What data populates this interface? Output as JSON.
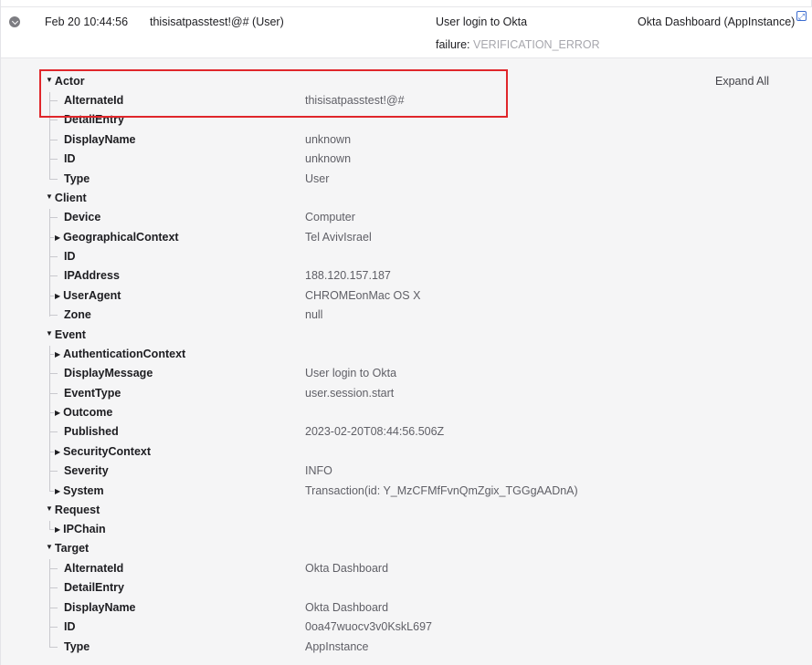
{
  "event": {
    "time": "Feb 20 10:44:56",
    "actor": "thisisatpasstest!@# (User)",
    "message": "User login to Okta",
    "outcome_label": "failure",
    "outcome_reason": "VERIFICATION_ERROR",
    "target": "Okta Dashboard  (AppInstance)"
  },
  "detail": {
    "expand_all": "Expand All",
    "sections": [
      {
        "label": "Actor",
        "rows": [
          {
            "label": "AlternateId",
            "value": "thisisatpasstest!@#"
          },
          {
            "label": "DetailEntry",
            "value": ""
          },
          {
            "label": "DisplayName",
            "value": "unknown"
          },
          {
            "label": "ID",
            "value": "unknown"
          },
          {
            "label": "Type",
            "value": "User"
          }
        ]
      },
      {
        "label": "Client",
        "rows": [
          {
            "label": "Device",
            "value": "Computer"
          },
          {
            "label": "GeographicalContext",
            "value": "Tel AvivIsrael"
          },
          {
            "label": "ID",
            "value": ""
          },
          {
            "label": "IPAddress",
            "value": "188.120.157.187"
          },
          {
            "label": "UserAgent",
            "value": "CHROMEonMac OS X"
          },
          {
            "label": "Zone",
            "value": "null"
          }
        ]
      },
      {
        "label": "Event",
        "rows": [
          {
            "label": "AuthenticationContext",
            "value": ""
          },
          {
            "label": "DisplayMessage",
            "value": "User login to Okta"
          },
          {
            "label": "EventType",
            "value": "user.session.start"
          },
          {
            "label": "Outcome",
            "value": ""
          },
          {
            "label": "Published",
            "value": "2023-02-20T08:44:56.506Z"
          },
          {
            "label": "SecurityContext",
            "value": ""
          },
          {
            "label": "Severity",
            "value": "INFO"
          },
          {
            "label": "System",
            "value": "Transaction(id: Y_MzCFMfFvnQmZgix_TGGgAADnA)"
          }
        ]
      },
      {
        "label": "Request",
        "rows": [
          {
            "label": "IPChain",
            "value": ""
          }
        ]
      },
      {
        "label": "Target",
        "rows": [
          {
            "label": "AlternateId",
            "value": "Okta Dashboard"
          },
          {
            "label": "DetailEntry",
            "value": ""
          },
          {
            "label": "DisplayName",
            "value": "Okta Dashboard"
          },
          {
            "label": "ID",
            "value": "0oa47wuocv3v0KskL697"
          },
          {
            "label": "Type",
            "value": "AppInstance"
          }
        ]
      }
    ]
  }
}
